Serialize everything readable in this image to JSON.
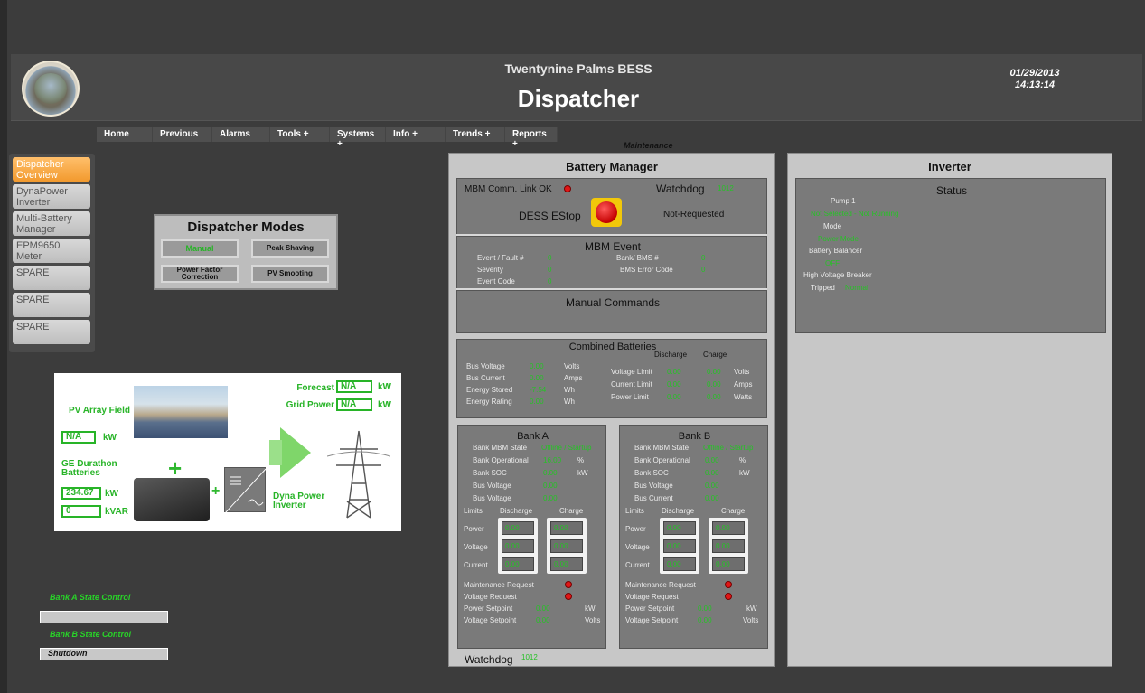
{
  "header": {
    "subtitle": "Twentynine Palms BESS",
    "title": "Dispatcher",
    "date": "01/29/2013",
    "time": "14:13:14"
  },
  "menu": [
    "Home",
    "Previous",
    "Alarms",
    "Tools +",
    "Systems +",
    "Info +",
    "Trends +",
    "Reports +"
  ],
  "maintenance_label": "Maintenance",
  "sidenav": [
    {
      "label": "Dispatcher Overview",
      "active": true
    },
    {
      "label": "DynaPower Inverter",
      "active": false
    },
    {
      "label": "Multi-Battery Manager",
      "active": false
    },
    {
      "label": "EPM9650 Meter",
      "active": false
    },
    {
      "label": "SPARE",
      "active": false
    },
    {
      "label": "SPARE",
      "active": false
    },
    {
      "label": "SPARE",
      "active": false
    }
  ],
  "modes": {
    "title": "Dispatcher Modes",
    "manual": "Manual",
    "peak_shaving": "Peak Shaving",
    "power_factor": "Power Factor Correction",
    "pv_smoothing": "PV Smooting"
  },
  "diagram": {
    "pv_array": "PV Array Field",
    "pv_value": "N/A",
    "pv_unit": "kW",
    "forecast_label": "Forecast",
    "forecast_value": "N/A",
    "forecast_unit": "kW",
    "grid_label": "Grid Power",
    "grid_value": "N/A",
    "grid_unit": "kW",
    "batteries_label": "GE Durathon Batteries",
    "batt_kw": "234.67",
    "batt_kw_unit": "kW",
    "batt_kvar": "0",
    "batt_kvar_unit": "kVAR",
    "inverter_label": "Dyna Power Inverter"
  },
  "state_control": {
    "bank_a_label": "Bank A State Control",
    "bank_a_value": "",
    "bank_b_label": "Bank B State Control",
    "bank_b_value": "Shutdown"
  },
  "battery_manager": {
    "title": "Battery Manager",
    "comm_link": "MBM Comm. Link OK",
    "watchdog_label": "Watchdog",
    "watchdog_value": "1012",
    "estop_label": "DESS EStop",
    "estop_state": "Not-Requested",
    "mbm_event_title": "MBM Event",
    "event_fault_label": "Event / Fault #",
    "event_fault_value": "0",
    "severity_label": "Severity",
    "severity_value": "0",
    "event_code_label": "Event Code",
    "event_code_value": "0",
    "bank_bms_label": "Bank/ BMS #",
    "bank_bms_value": "0",
    "bms_error_label": "BMS Error Code",
    "bms_error_value": "0",
    "manual_commands": "Manual Commands",
    "combined_title": "Combined Batteries",
    "discharge": "Discharge",
    "charge": "Charge",
    "bus_voltage_label": "Bus Voltage",
    "bus_voltage_value": "0.00",
    "bus_voltage_unit": "Volts",
    "bus_current_label": "Bus Current",
    "bus_current_value": "0.00",
    "bus_current_unit": "Amps",
    "energy_stored_label": "Energy Stored",
    "energy_stored_value": "-7.54",
    "energy_stored_unit": "Wh",
    "energy_rating_label": "Energy Rating",
    "energy_rating_value": "0.00",
    "energy_rating_unit": "Wh",
    "voltage_limit_label": "Voltage Limit",
    "voltage_limit_dis": "0.00",
    "voltage_limit_chg": "0.00",
    "voltage_limit_unit": "Volts",
    "current_limit_label": "Current Limit",
    "current_limit_dis": "0.00",
    "current_limit_chg": "0.00",
    "current_limit_unit": "Amps",
    "power_limit_label": "Power Limit",
    "power_limit_dis": "0.00",
    "power_limit_chg": "0.00",
    "power_limit_unit": "Watts",
    "bottom_watchdog_label": "Watchdog",
    "bottom_watchdog_value": "1012"
  },
  "banks": [
    {
      "title": "Bank A",
      "state_label": "Bank MBM State",
      "state_value": "Offline / Startup",
      "operational_label": "Bank Operational",
      "operational_value": "16.00",
      "operational_unit": "%",
      "soc_label": "Bank SOC",
      "soc_value": "0.00",
      "soc_unit": "kW",
      "row4_label": "Bus Voltage",
      "row4_value": "0.00",
      "row5_label": "Bus Voltage",
      "row5_value": "0.00",
      "limits": "Limits",
      "discharge": "Discharge",
      "charge": "Charge",
      "power_label": "Power",
      "voltage_label": "Voltage",
      "current_label": "Current",
      "power_dis": "0.00",
      "power_chg": "0.00",
      "voltage_dis": "0.00",
      "voltage_chg": "0.00",
      "current_dis": "0.00",
      "current_chg": "0.00",
      "maint_req": "Maintenance Request",
      "volt_req": "Voltage Request",
      "power_setpoint_label": "Power Setpoint",
      "power_setpoint_value": "0.00",
      "power_setpoint_unit": "kW",
      "voltage_setpoint_label": "Voltage Setpoint",
      "voltage_setpoint_value": "0.00",
      "voltage_setpoint_unit": "Volts"
    },
    {
      "title": "Bank B",
      "state_label": "Bank MBM State",
      "state_value": "Offline / Startup",
      "operational_label": "Bank Operational",
      "operational_value": "0.00",
      "operational_unit": "%",
      "soc_label": "Bank SOC",
      "soc_value": "0.00",
      "soc_unit": "kW",
      "row4_label": "Bus Voltage",
      "row4_value": "0.00",
      "row5_label": "Bus Current",
      "row5_value": "0.00",
      "limits": "Limits",
      "discharge": "Discharge",
      "charge": "Charge",
      "power_label": "Power",
      "voltage_label": "Voltage",
      "current_label": "Current",
      "power_dis": "0.00",
      "power_chg": "0.00",
      "voltage_dis": "0.00",
      "voltage_chg": "0.00",
      "current_dis": "0.00",
      "current_chg": "0.00",
      "maint_req": "Maintenance Request",
      "volt_req": "Voltage Request",
      "power_setpoint_label": "Power Setpoint",
      "power_setpoint_value": "0.00",
      "power_setpoint_unit": "kW",
      "voltage_setpoint_label": "Voltage Setpoint",
      "voltage_setpoint_value": "0.00",
      "voltage_setpoint_unit": "Volts"
    }
  ],
  "inverter": {
    "title": "Inverter",
    "status": "Status",
    "pump_label": "Pump 1",
    "pump_value": "Not Selected - Not Running",
    "mode_label": "Mode",
    "mode_value": "Power Mode",
    "balancer_label": "Battery Balancer",
    "balancer_value": "OFF",
    "hv_label": "High Voltage Breaker",
    "tripped_label": "Tripped",
    "tripped_value": "Normal"
  },
  "colors": {
    "background": "#3c3c3c",
    "panel": "#c7c7c7",
    "value_green": "#27c127",
    "active_nav": "#f29a2e",
    "alarm_red": "#e01616"
  }
}
